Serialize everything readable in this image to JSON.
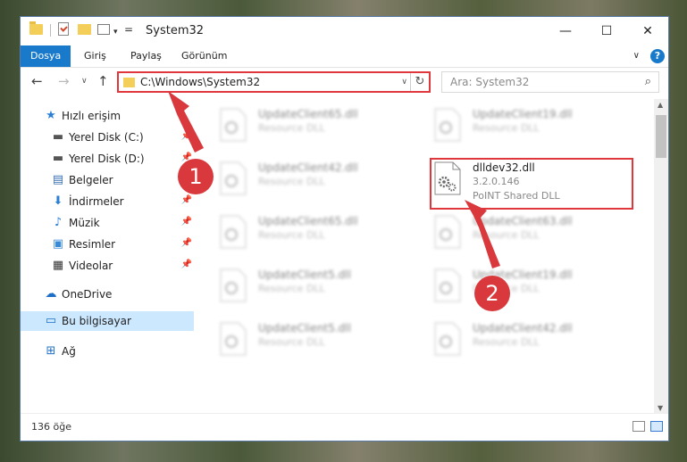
{
  "window": {
    "title": "System32",
    "quick_access_dropdown": "▾",
    "quick_access_customize": "=",
    "minimize": "—",
    "maximize": "☐",
    "close": "✕"
  },
  "ribbon": {
    "tabs": [
      "Dosya",
      "Giriş",
      "Paylaş",
      "Görünüm"
    ],
    "expand": "∨",
    "help": "?"
  },
  "navigation": {
    "back": "←",
    "forward": "→",
    "recent": "∨",
    "up": "↑",
    "address": "C:\\Windows\\System32",
    "address_dropdown": "∨",
    "refresh": "↻",
    "search_placeholder": "Ara: System32"
  },
  "sidebar": {
    "items": [
      {
        "label": "Hızlı erişim",
        "icon": "star-icon",
        "pinned": false
      },
      {
        "label": "Yerel Disk (C:)",
        "icon": "drive-icon",
        "pinned": true
      },
      {
        "label": "Yerel Disk (D:)",
        "icon": "drive-icon",
        "pinned": true
      },
      {
        "label": "Belgeler",
        "icon": "documents-icon",
        "pinned": true
      },
      {
        "label": "İndirmeler",
        "icon": "download-icon",
        "pinned": true
      },
      {
        "label": "Müzik",
        "icon": "music-icon",
        "pinned": true
      },
      {
        "label": "Resimler",
        "icon": "pictures-icon",
        "pinned": true
      },
      {
        "label": "Videolar",
        "icon": "video-icon",
        "pinned": true
      },
      {
        "label": "OneDrive",
        "icon": "cloud-icon",
        "pinned": false
      },
      {
        "label": "Bu bilgisayar",
        "icon": "computer-icon",
        "pinned": false,
        "selected": true
      },
      {
        "label": "Ağ",
        "icon": "network-icon",
        "pinned": false
      }
    ]
  },
  "files": [
    {
      "name": "UpdateClient65.dll",
      "desc": "Resource DLL",
      "blurred": true
    },
    {
      "name": "UpdateClient19.dll",
      "desc": "Resource DLL",
      "blurred": true
    },
    {
      "name": "UpdateClient42.dll",
      "desc": "Resource DLL",
      "blurred": true
    },
    {
      "name": "dlldev32.dll",
      "version": "3.2.0.146",
      "desc": "PoINT Shared DLL",
      "blurred": false
    },
    {
      "name": "UpdateClient65.dll",
      "desc": "Resource DLL",
      "blurred": true
    },
    {
      "name": "UpdateClient63.dll",
      "desc": "Resource DLL",
      "blurred": true
    },
    {
      "name": "UpdateClient5.dll",
      "desc": "Resource DLL",
      "blurred": true
    },
    {
      "name": "UpdateClient19.dll",
      "desc": "Resource DLL",
      "blurred": true
    },
    {
      "name": "UpdateClient5.dll",
      "desc": "Resource DLL",
      "blurred": true
    },
    {
      "name": "UpdateClient42.dll",
      "desc": "Resource DLL",
      "blurred": true
    }
  ],
  "status": {
    "item_count": "136 öğe"
  },
  "annotations": {
    "step1": "1",
    "step2": "2",
    "color": "#d9383c"
  }
}
